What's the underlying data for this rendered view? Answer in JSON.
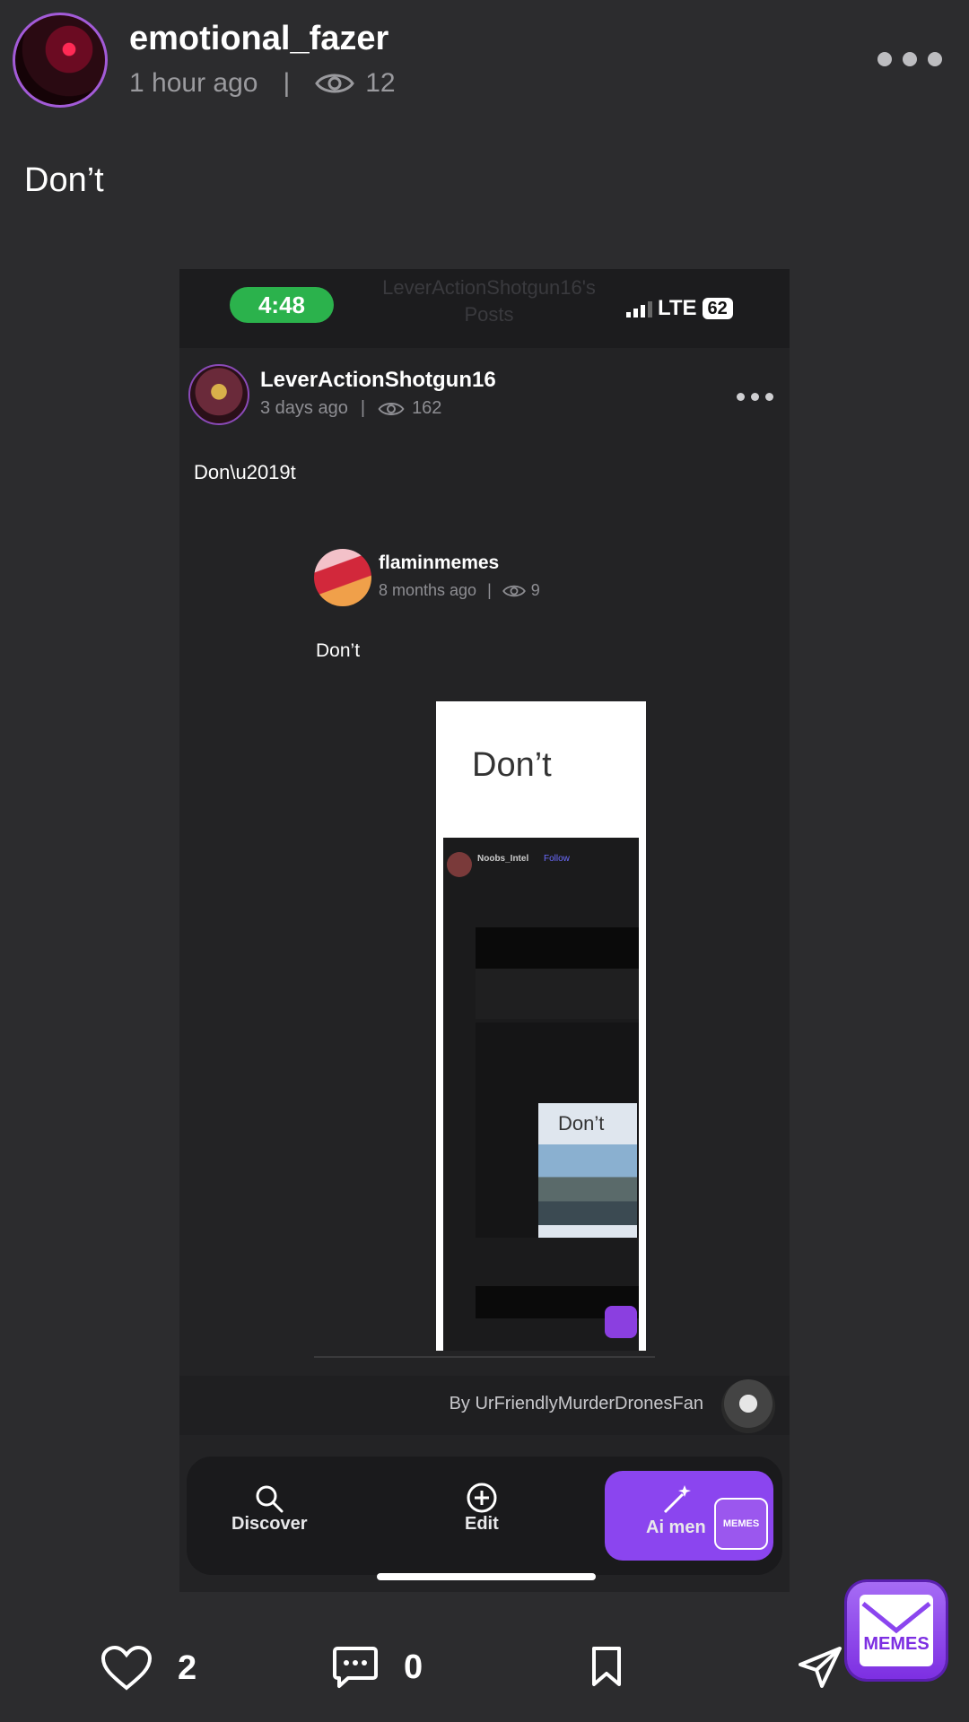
{
  "post": {
    "username": "emotional_fazer",
    "time": "1 hour ago",
    "separator": "|",
    "views": "12",
    "caption": "Don’t"
  },
  "screenshot": {
    "status_time": "4:48",
    "ghost_title": "LeverActionShotgun16's Posts",
    "network": "LTE",
    "battery": "62",
    "post": {
      "username": "LeverActionShotgun16",
      "time": "3 days ago",
      "separator": "|",
      "views": "162",
      "caption": "Don\\u2019t"
    },
    "quoted": {
      "username": "flaminmemes",
      "time": "8 months ago",
      "separator": "|",
      "views": "9",
      "caption": "Don’t",
      "image_caption": "Don’t",
      "nested_caption": "Don’t",
      "nested_user": "Noobs_Intel",
      "nested_follow": "Follow"
    },
    "byline": "By UrFriendlyMurderDronesFan",
    "nav": {
      "discover": "Discover",
      "edit": "Edit",
      "ai": "Ai men"
    },
    "mini_badge": "MEMES"
  },
  "actions": {
    "likes": "2",
    "comments": "0"
  },
  "badge": {
    "label": "MEMES"
  },
  "colors": {
    "background": "#2c2c2e",
    "accent": "#8b45ef",
    "status_green": "#2bb24c"
  }
}
